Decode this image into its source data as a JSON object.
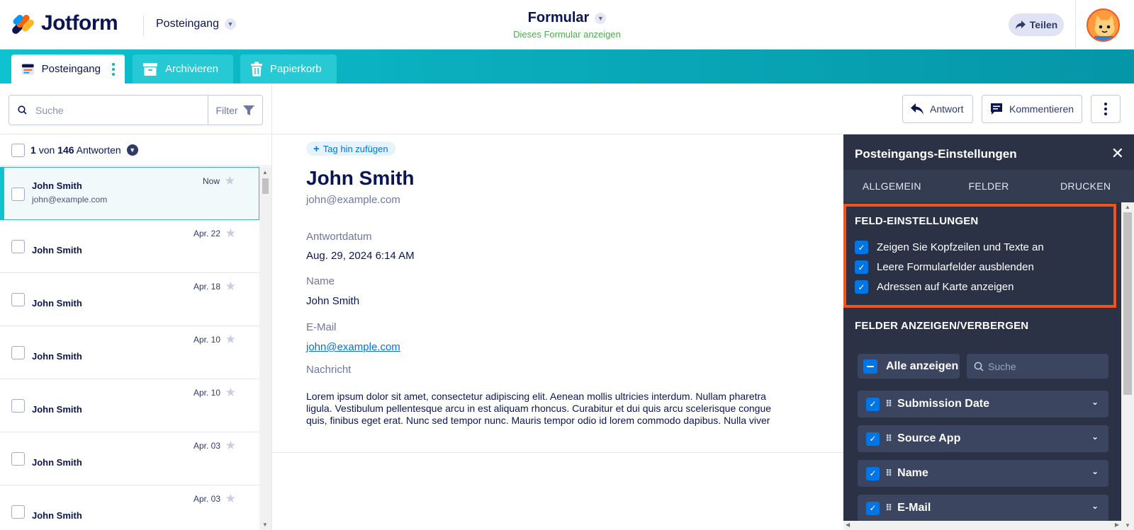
{
  "header": {
    "brand": "Jotform",
    "inbox_dropdown": "Posteingang",
    "form_title": "Formular",
    "form_subtitle": "Dieses Formular anzeigen",
    "share_label": "Teilen"
  },
  "tabs": [
    {
      "label": "Posteingang",
      "icon": "inbox-icon"
    },
    {
      "label": "Archivieren",
      "icon": "archive-icon"
    },
    {
      "label": "Papierkorb",
      "icon": "trash-icon"
    }
  ],
  "sidebar": {
    "search_placeholder": "Suche",
    "filter_label": "Filter",
    "count_selected": "1",
    "count_sep": "von",
    "count_total": "146",
    "count_suffix": "Antworten",
    "items": [
      {
        "name": "John Smith",
        "email": "john@example.com",
        "date": "Now",
        "active": true
      },
      {
        "name": "John Smith",
        "date": "Apr. 22"
      },
      {
        "name": "John Smith",
        "date": "Apr. 18"
      },
      {
        "name": "John Smith",
        "date": "Apr. 10"
      },
      {
        "name": "John Smith",
        "date": "Apr. 10"
      },
      {
        "name": "John Smith",
        "date": "Apr. 03"
      },
      {
        "name": "John Smith",
        "date": "Apr. 03"
      }
    ]
  },
  "toolbar": {
    "answer_label": "Antwort",
    "comment_label": "Kommentieren"
  },
  "submission": {
    "add_tag": "Tag hin zufügen",
    "name": "John Smith",
    "email": "john@example.com",
    "fields": [
      {
        "label": "Antwortdatum",
        "value": "Aug. 29, 2024 6:14 AM"
      },
      {
        "label": "Name",
        "value": "John Smith"
      },
      {
        "label": "E-Mail",
        "value": "john@example.com"
      },
      {
        "label": "Nachricht"
      }
    ],
    "message_lines": [
      "Lorem ipsum dolor sit amet, consectetur adipiscing elit. Aenean mollis ultricies interdum. Nullam pharetra",
      "ligula. Vestibulum pellentesque arcu in est aliquam rhoncus. Curabitur et dui quis arcu scelerisque congue",
      "quis, finibus eget erat. Nunc sed tempor nunc. Mauris tempor odio id lorem commodo dapibus. Nulla viver"
    ]
  },
  "settings_panel": {
    "title": "Posteingangs-Einstellungen",
    "tabs": [
      "ALLGEMEIN",
      "FELDER",
      "DRUCKEN"
    ],
    "field_settings_title": "FELD-EINSTELLUNGEN",
    "field_settings": [
      {
        "label": "Zeigen Sie Kopfzeilen und Texte an",
        "checked": true
      },
      {
        "label": "Leere Formularfelder ausblenden",
        "checked": true
      },
      {
        "label": "Adressen auf Karte anzeigen",
        "checked": true
      }
    ],
    "show_hide_title": "FELDER ANZEIGEN/VERBERGEN",
    "show_all_label": "Alle anzeigen",
    "search_placeholder": "Suche",
    "fields": [
      {
        "label": "Submission Date",
        "checked": true
      },
      {
        "label": "Source App",
        "checked": true
      },
      {
        "label": "Name",
        "checked": true
      },
      {
        "label": "E-Mail",
        "checked": true
      }
    ],
    "highlight_color": "#f4511e"
  },
  "colors": {
    "brand_teal": "#0ec2cf",
    "navy": "#0a1551",
    "link_blue": "#0075e3",
    "panel_bg": "#2b3245"
  }
}
